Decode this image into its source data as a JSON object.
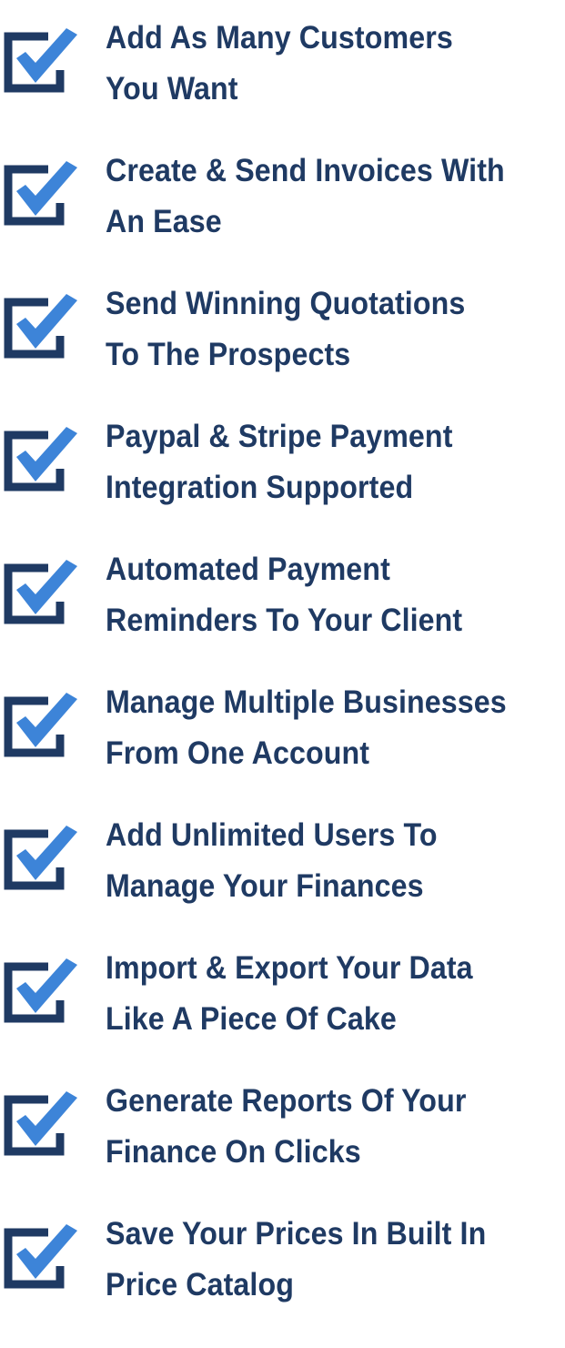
{
  "colors": {
    "text": "#1f3a63",
    "box": "#1f3a63",
    "check": "#3d84d8"
  },
  "icon": "checked-box-icon",
  "features": [
    {
      "line1": "Add As Many Customers",
      "line2": "You Want"
    },
    {
      "line1": "Create & Send Invoices With",
      "line2": "An Ease"
    },
    {
      "line1": "Send Winning Quotations",
      "line2": "To The Prospects"
    },
    {
      "line1": "Paypal & Stripe Payment",
      "line2": "Integration Supported"
    },
    {
      "line1": "Automated Payment",
      "line2": "Reminders To Your Client"
    },
    {
      "line1": "Manage Multiple Businesses",
      "line2": "From One Account"
    },
    {
      "line1": "Add Unlimited Users To",
      "line2": "Manage Your Finances"
    },
    {
      "line1": "Import & Export Your Data",
      "line2": "Like A Piece Of Cake"
    },
    {
      "line1": "Generate Reports Of Your",
      "line2": "Finance On Clicks"
    },
    {
      "line1": "Save Your Prices In Built In",
      "line2": "Price Catalog"
    }
  ]
}
